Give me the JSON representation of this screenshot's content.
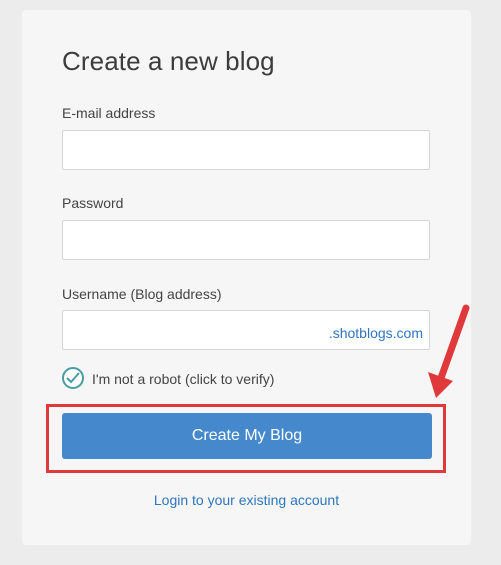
{
  "form": {
    "title": "Create a new blog",
    "email_label": "E-mail address",
    "email_value": "",
    "password_label": "Password",
    "password_value": "",
    "username_label": "Username (Blog address)",
    "username_value": "",
    "username_suffix": ".shotblogs.com",
    "captcha_label": "I'm not a robot (click to verify)",
    "submit_label": "Create My Blog",
    "login_link": "Login to your existing account"
  },
  "annotation": {
    "highlight_color": "#e0393c"
  },
  "colors": {
    "button": "#4589cc",
    "link": "#2e76c0"
  }
}
